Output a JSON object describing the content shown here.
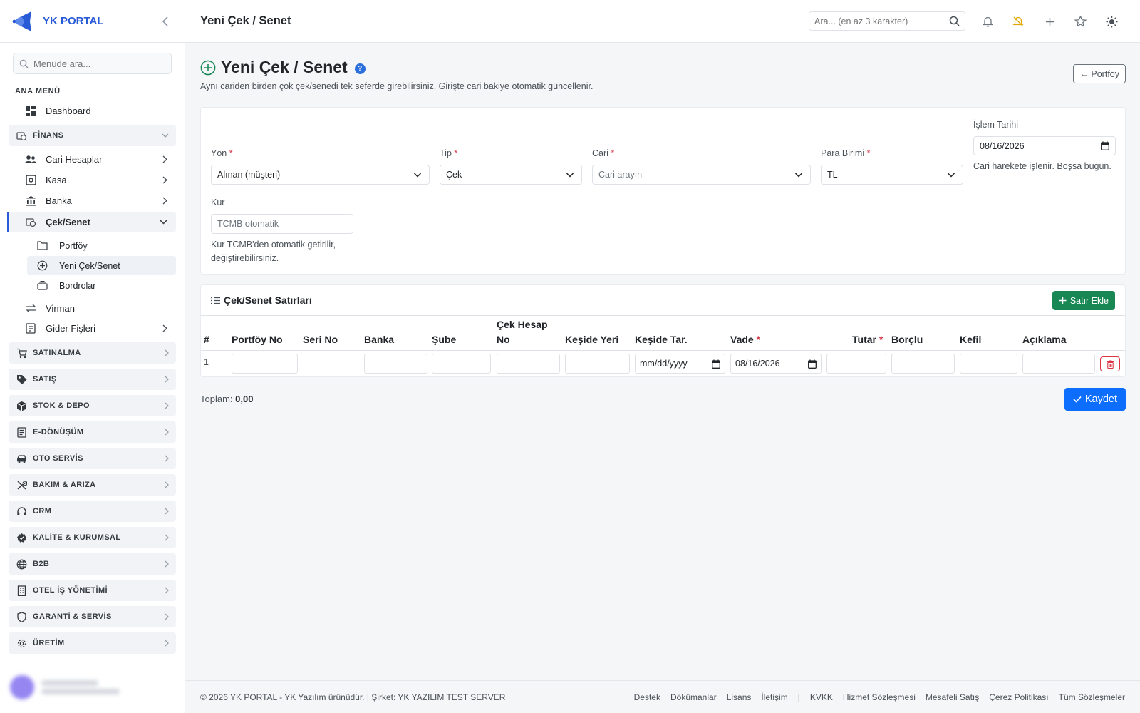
{
  "brand": {
    "name": "YK PORTAL",
    "color": "#2a5bd7"
  },
  "sidebar": {
    "search_placeholder": "Menüde ara...",
    "section_title": "ANA MENÜ",
    "dashboard": "Dashboard",
    "finans": "FİNANS",
    "finans_items": [
      {
        "label": "Cari Hesaplar",
        "icon": "users-icon"
      },
      {
        "label": "Kasa",
        "icon": "safe-icon"
      },
      {
        "label": "Banka",
        "icon": "bank-icon"
      },
      {
        "label": "Çek/Senet",
        "icon": "cheque-icon"
      }
    ],
    "cek_sub": [
      {
        "label": "Portföy",
        "icon": "folder-icon"
      },
      {
        "label": "Yeni Çek/Senet",
        "icon": "plus-circle-icon"
      },
      {
        "label": "Bordrolar",
        "icon": "archive-icon"
      }
    ],
    "virman": "Virman",
    "gider": "Gider Fişleri",
    "groups": [
      {
        "label": "SATINALMA",
        "icon": "cart-icon"
      },
      {
        "label": "SATIŞ",
        "icon": "tag-icon"
      },
      {
        "label": "STOK & DEPO",
        "icon": "box-icon"
      },
      {
        "label": "E-DÖNÜŞÜM",
        "icon": "document-icon"
      },
      {
        "label": "OTO SERVİS",
        "icon": "car-icon"
      },
      {
        "label": "BAKIM & ARIZA",
        "icon": "tools-icon"
      },
      {
        "label": "CRM",
        "icon": "headset-icon"
      },
      {
        "label": "KALİTE & KURUMSAL",
        "icon": "badge-icon"
      },
      {
        "label": "B2B",
        "icon": "globe-icon"
      },
      {
        "label": "OTEL İŞ YÖNETİMİ",
        "icon": "building-icon"
      },
      {
        "label": "GARANTİ & SERVİS",
        "icon": "shield-icon"
      },
      {
        "label": "ÜRETİM",
        "icon": "gear-icon"
      }
    ]
  },
  "header": {
    "title": "Yeni Çek / Senet",
    "search_placeholder": "Ara... (en az 3 karakter)"
  },
  "page": {
    "title": "Yeni Çek / Senet",
    "help": "?",
    "subtitle": "Aynı cariden birden çok çek/senedi tek seferde girebilirsiniz. Girişte cari bakiye otomatik güncellenir.",
    "back_label": "← Portföy"
  },
  "form": {
    "yon": {
      "label": "Yön",
      "value": "Alınan (müşteri)"
    },
    "tip": {
      "label": "Tip",
      "value": "Çek"
    },
    "cari": {
      "label": "Cari",
      "placeholder": "Cari arayın"
    },
    "para": {
      "label": "Para Birimi",
      "value": "TL"
    },
    "tarih": {
      "label": "İşlem Tarihi",
      "value": "08/16/2026",
      "hint": "Cari harekete işlenir. Boşsa bugün."
    },
    "kur": {
      "label": "Kur",
      "placeholder": "TCMB otomatik",
      "hint": "Kur TCMB'den otomatik getirilir, değiştirebilirsiniz."
    }
  },
  "lines": {
    "title": "Çek/Senet Satırları",
    "add_label": "Satır Ekle",
    "columns": [
      "#",
      "Portföy No",
      "Seri No",
      "Banka",
      "Şube",
      "Çek Hesap No",
      "Keşide Yeri",
      "Keşide Tar.",
      "Vade",
      "Tutar",
      "Borçlu",
      "Kefil",
      "Açıklama"
    ],
    "row": {
      "num": "1",
      "keside_tar": "mm/dd/yyyy",
      "vade": "08/16/2026"
    }
  },
  "totals": {
    "label": "Toplam:",
    "value": "0,00"
  },
  "save_label": "Kaydet",
  "footer": {
    "copyright": "© 2026 YK PORTAL - YK Yazılım ürünüdür. | Şirket: YK YAZILIM TEST SERVER",
    "links_a": [
      "Destek",
      "Dökümanlar",
      "Lisans",
      "İletişim"
    ],
    "links_b": [
      "KVKK",
      "Hizmet Sözleşmesi",
      "Mesafeli Satış",
      "Çerez Politikası",
      "Tüm Sözleşmeler"
    ]
  },
  "colors": {
    "primary": "#0d6efd",
    "success": "#198754",
    "danger": "#dc3545",
    "accent_bell": "#e0a800"
  }
}
